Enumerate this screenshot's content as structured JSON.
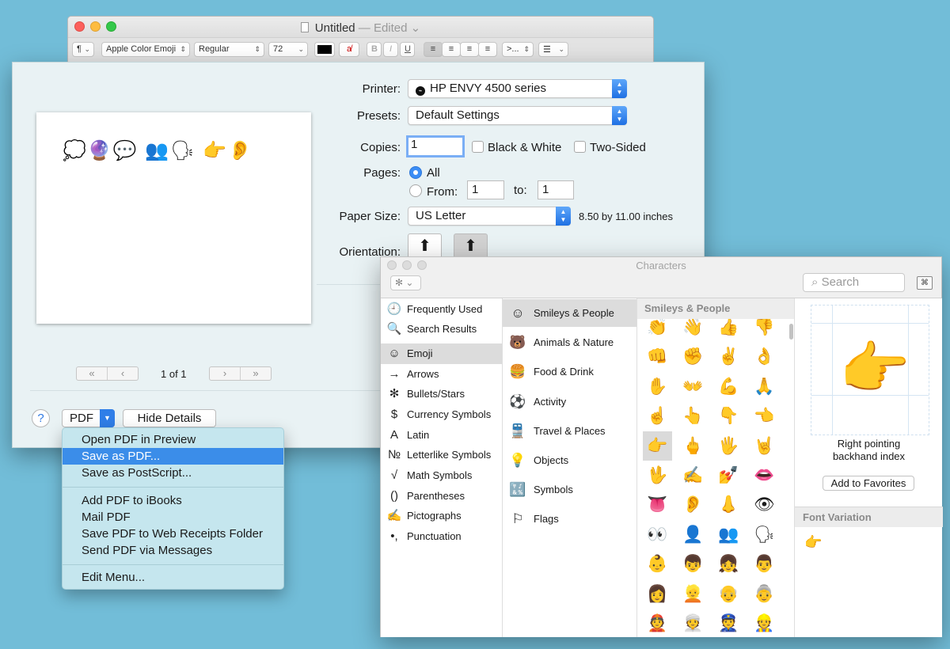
{
  "textedit": {
    "title": "Untitled",
    "edited": " — Edited ⌄",
    "toolbar": {
      "paragraph": "¶",
      "font": "Apple Color Emoji",
      "style": "Regular",
      "size": "72",
      "bold": "B",
      "italic": "I",
      "underline": "U",
      "spacing": ">...",
      "list": "☰"
    }
  },
  "print": {
    "preview_text": "💭🔮💬 👥🗣 👉👂",
    "page_count": "1 of 1",
    "printer_label": "Printer:",
    "printer_value": "HP ENVY 4500 series",
    "presets_label": "Presets:",
    "presets_value": "Default Settings",
    "copies_label": "Copies:",
    "copies_value": "1",
    "bw_label": "Black & White",
    "two_sided_label": "Two-Sided",
    "pages_label": "Pages:",
    "pages_all": "All",
    "pages_from": "From:",
    "from_value": "1",
    "to_label": "to:",
    "to_value": "1",
    "paper_label": "Paper Size:",
    "paper_value": "US Letter",
    "paper_dims": "8.50 by 11.00 inches",
    "orientation_label": "Orientation:",
    "help": "?",
    "pdf_label": "PDF",
    "hide_details": "Hide Details"
  },
  "pdf_menu": {
    "items": [
      "Open PDF in Preview",
      "Save as PDF...",
      "Save as PostScript...",
      "Add PDF to iBooks",
      "Mail PDF",
      "Save PDF to Web Receipts Folder",
      "Send PDF via Messages",
      "Edit Menu..."
    ],
    "highlighted": "Save as PDF..."
  },
  "characters": {
    "title": "Characters",
    "search_placeholder": "Search",
    "categories": [
      {
        "icon": "clock-icon",
        "glyph": "🕘",
        "label": "Frequently Used"
      },
      {
        "icon": "magnifier-icon",
        "glyph": "🔍",
        "label": "Search Results"
      },
      {
        "icon": "smiley-icon",
        "glyph": "☺",
        "label": "Emoji"
      },
      {
        "icon": "arrow-icon",
        "glyph": "→",
        "label": "Arrows"
      },
      {
        "icon": "asterisk-icon",
        "glyph": "✻",
        "label": "Bullets/Stars"
      },
      {
        "icon": "dollar-icon",
        "glyph": "$",
        "label": "Currency Symbols"
      },
      {
        "icon": "latin-icon",
        "glyph": "A",
        "label": "Latin"
      },
      {
        "icon": "numero-icon",
        "glyph": "№",
        "label": "Letterlike Symbols"
      },
      {
        "icon": "sqrt-icon",
        "glyph": "√",
        "label": "Math Symbols"
      },
      {
        "icon": "paren-icon",
        "glyph": "()",
        "label": "Parentheses"
      },
      {
        "icon": "pictograph-icon",
        "glyph": "✍",
        "label": "Pictographs"
      },
      {
        "icon": "punctuation-icon",
        "glyph": "•,",
        "label": "Punctuation"
      }
    ],
    "emoji_categories": [
      {
        "glyph": "☺",
        "label": "Smileys & People"
      },
      {
        "glyph": "🐻",
        "label": "Animals & Nature"
      },
      {
        "glyph": "🍔",
        "label": "Food & Drink"
      },
      {
        "glyph": "⚽",
        "label": "Activity"
      },
      {
        "glyph": "🚆",
        "label": "Travel & Places"
      },
      {
        "glyph": "💡",
        "label": "Objects"
      },
      {
        "glyph": "🔣",
        "label": "Symbols"
      },
      {
        "glyph": "⚐",
        "label": "Flags"
      }
    ],
    "grid_header": "Smileys & People",
    "grid": [
      "👏",
      "👋",
      "👍",
      "👎",
      "👊",
      "✊",
      "✌",
      "👌",
      "✋",
      "👐",
      "💪",
      "🙏",
      "☝",
      "👆",
      "👇",
      "👈",
      "👉",
      "🖕",
      "🖐",
      "🤘",
      "🖖",
      "✍",
      "💅",
      "👄",
      "👅",
      "👂",
      "👃",
      "👁",
      "👀",
      "👤",
      "👥",
      "🗣",
      "👶",
      "👦",
      "👧",
      "👨",
      "👩",
      "👱",
      "👴",
      "👵",
      "👲",
      "👳",
      "👮",
      "👷"
    ],
    "selected_glyph": "👉",
    "char_name_line1": "Right pointing",
    "char_name_line2": "backhand index",
    "add_favorites": "Add to Favorites",
    "font_variation": "Font Variation",
    "variation_glyph": "👉"
  }
}
